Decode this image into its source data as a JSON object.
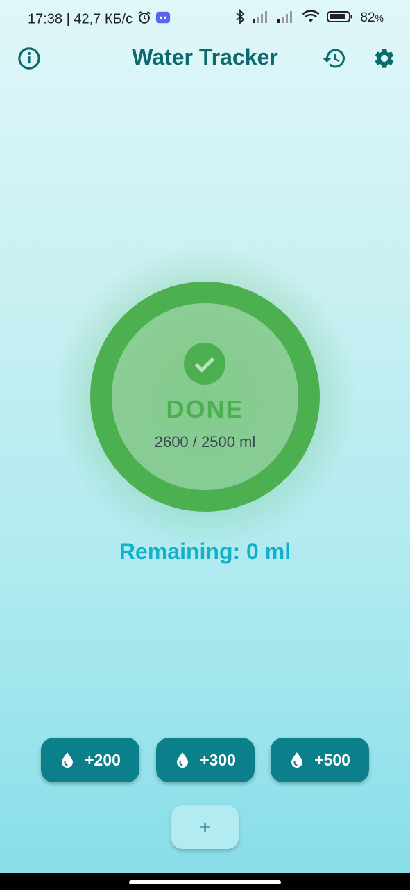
{
  "status_bar": {
    "time_speed": "17:38 | 42,7 КБ/с",
    "battery_pct": "82",
    "battery_unit": "%",
    "icons": [
      "alarm-icon",
      "discord-icon",
      "bluetooth-icon",
      "signal-icon",
      "signal-icon",
      "wifi-icon",
      "battery-icon"
    ]
  },
  "app_bar": {
    "title": "Water Tracker",
    "icons": [
      "info-icon",
      "history-icon",
      "settings-icon"
    ]
  },
  "progress": {
    "status": "DONE",
    "amount": "2600 / 2500 ml",
    "consumed_ml": 2600,
    "goal_ml": 2500,
    "fraction": 1.0,
    "ring_color": "#4caf50"
  },
  "remaining_text": "Remaining: 0 ml",
  "quick_add": [
    {
      "label": "+200",
      "icon": "water-drop-icon"
    },
    {
      "label": "+300",
      "icon": "water-drop-icon"
    },
    {
      "label": "+500",
      "icon": "water-drop-icon"
    }
  ],
  "custom_add_label": "+",
  "colors": {
    "accent": "#0b7f8a",
    "title": "#0a6a6e",
    "success": "#4caf50",
    "remaining": "#11b1c9"
  }
}
